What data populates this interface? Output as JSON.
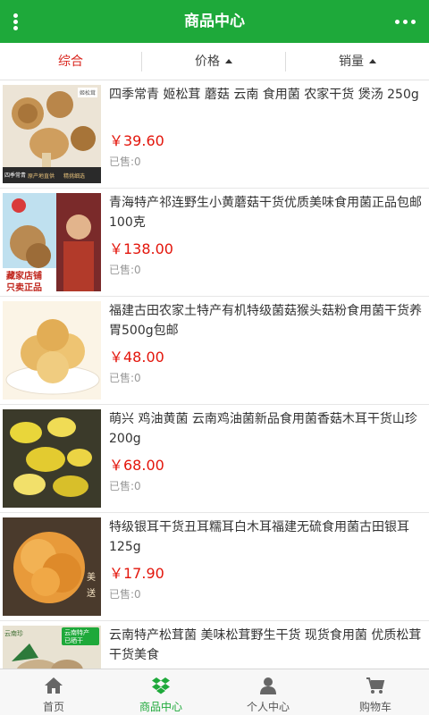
{
  "header": {
    "title": "商品中心"
  },
  "sortbar": {
    "comprehensive": "综合",
    "price": "价格",
    "sales": "销量"
  },
  "products": [
    {
      "name": "四季常青 姬松茸 蘑菇 云南 食用菌 农家干货 煲汤 250g",
      "price": "￥39.60",
      "sold": "已售:0",
      "image_text": [
        "姬松茸",
        "原产地直供",
        "精挑细选",
        "四季常青"
      ]
    },
    {
      "name": "青海特产祁连野生小黄蘑菇干货优质美味食用菌正品包邮100克",
      "price": "￥138.00",
      "sold": "已售:0",
      "image_text": [
        "藏家店铺",
        "只卖正品"
      ]
    },
    {
      "name": "福建古田农家土特产有机特级菌菇猴头菇粉食用菌干货养胃500g包邮",
      "price": "￥48.00",
      "sold": "已售:0",
      "image_text": []
    },
    {
      "name": "萌兴 鸡油黄菌 云南鸡油菌新品食用菌香菇木耳干货山珍200g",
      "price": "￥68.00",
      "sold": "已售:0",
      "image_text": []
    },
    {
      "name": "特级银耳干货丑耳糯耳白木耳福建无硫食用菌古田银耳125g",
      "price": "￥17.90",
      "sold": "已售:0",
      "image_text": [
        "美",
        "送"
      ]
    },
    {
      "name": "云南特产松茸菌 美味松茸野生干货 现货食用菌 优质松茸干货美食",
      "price": "",
      "sold": "",
      "image_text": [
        "云南特产",
        "已晒干",
        "云南珍"
      ]
    }
  ],
  "tabbar": {
    "home": "首页",
    "products": "商品中心",
    "profile": "个人中心",
    "cart": "购物车"
  },
  "colors": {
    "brand_green": "#1ea93a",
    "price_red": "#e3150b",
    "active_sort": "#d9251d"
  },
  "icons": {
    "menu": "vertical-dots-icon",
    "more": "horizontal-dots-icon",
    "home": "house-icon",
    "products": "dropbox-icon",
    "profile": "person-icon",
    "cart": "cart-icon"
  }
}
